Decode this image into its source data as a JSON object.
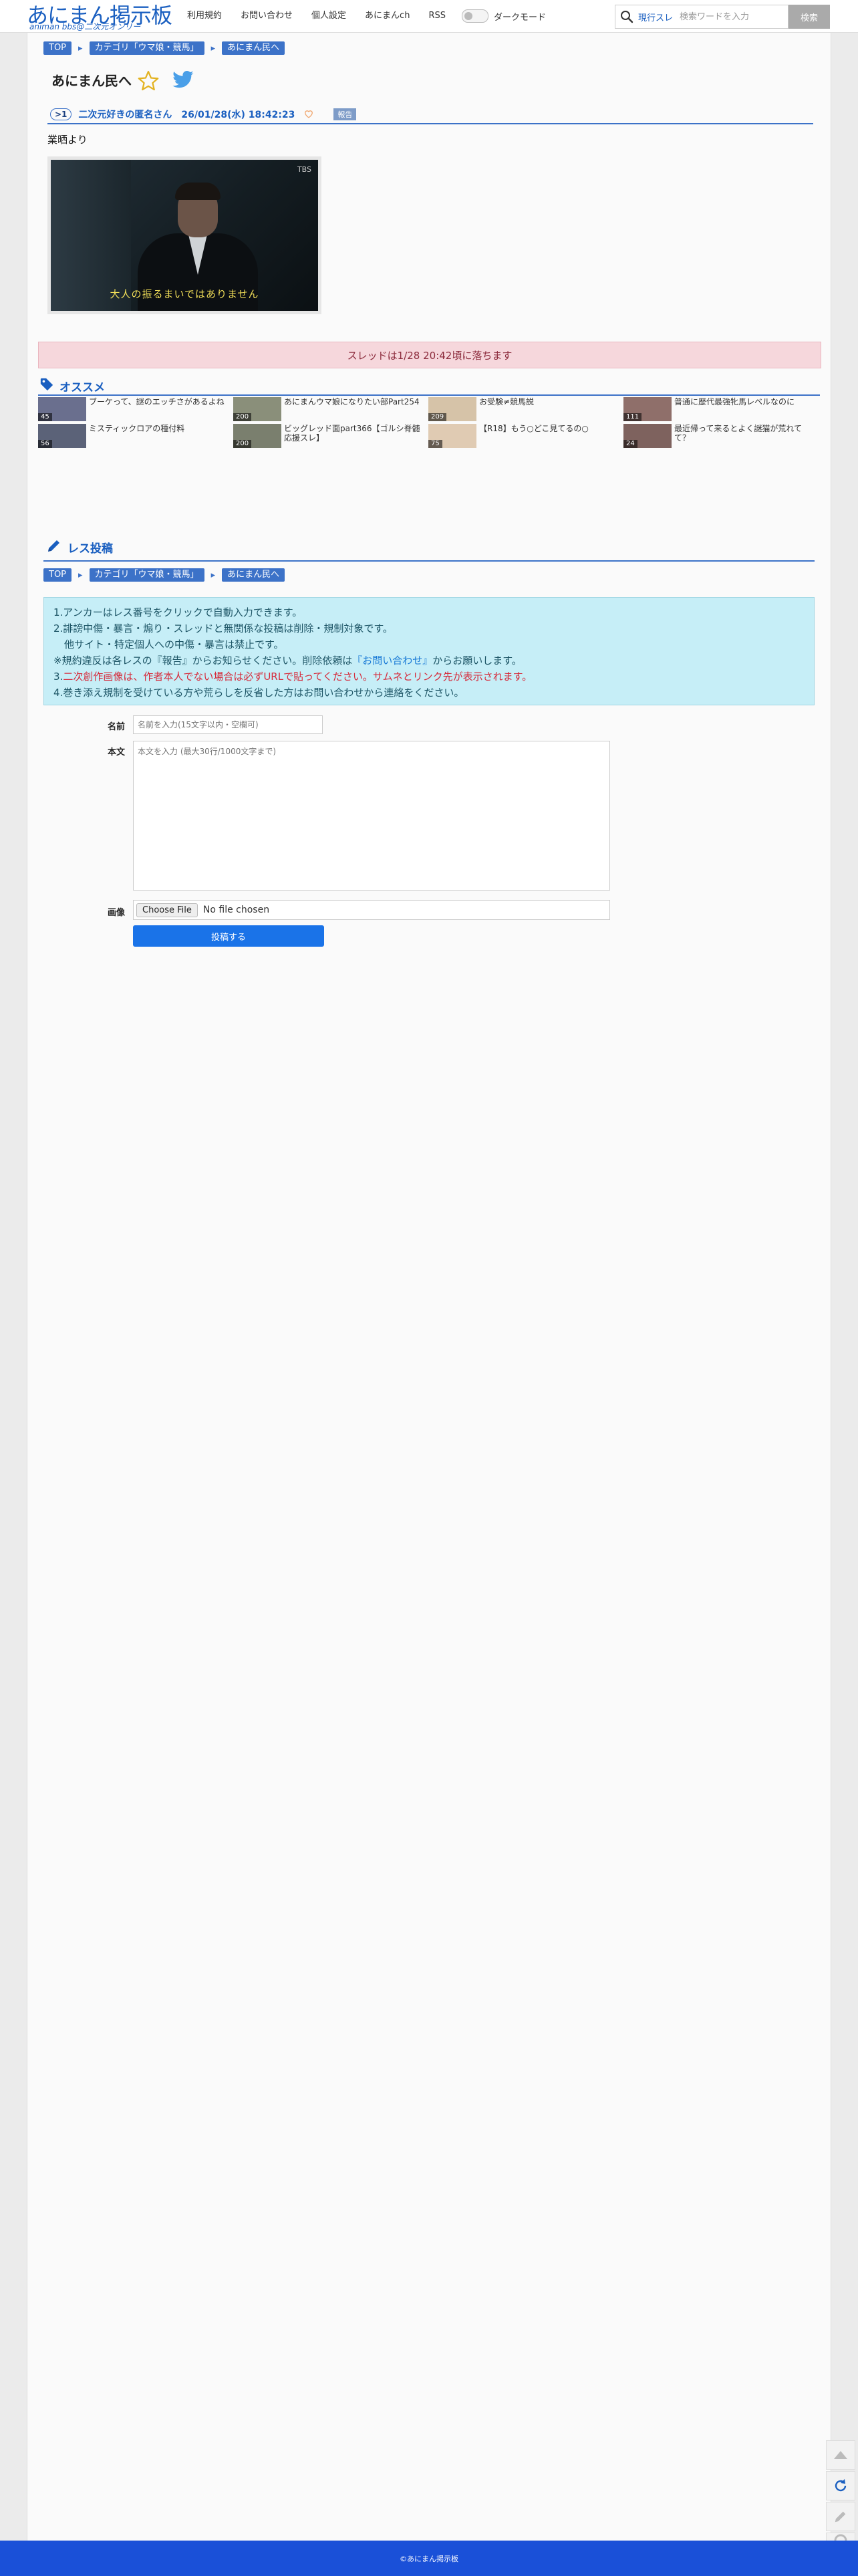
{
  "header": {
    "logo_main": "あにまん掲示板",
    "logo_sub": "animan bbs@二次元オンリー",
    "nav": [
      "利用規約",
      "お問い合わせ",
      "個人設定",
      "あにまんch",
      "RSS"
    ],
    "dark_mode_label": "ダークモード",
    "search_scope": "現行スレ",
    "search_placeholder": "検索ワードを入力",
    "search_button": "検索"
  },
  "breadcrumb": [
    "TOP",
    "カテゴリ「ウマ娘・競馬」",
    "あにまん民へ"
  ],
  "thread": {
    "title": "あにまん民へ",
    "res": {
      "number": ">1",
      "name": "二次元好きの匿名さん",
      "date": "26/01/28(水) 18:42:23",
      "report": "報告",
      "body": "業晒より",
      "image_subtitle": "大人の振るまいではありません",
      "image_logo": "TBS"
    },
    "notice": "スレッドは1/28 20:42頃に落ちます"
  },
  "recommend": {
    "heading": "オススメ",
    "items": [
      {
        "title": "ブーケって、謎のエッチさがあるよね",
        "count": "45"
      },
      {
        "title": "あにまんウマ娘になりたい部Part254",
        "count": "200"
      },
      {
        "title": "お受験≠競馬説",
        "count": "209"
      },
      {
        "title": "普通に歴代最強牝馬レベルなのに",
        "count": "111"
      },
      {
        "title": "ミスティックロアの種付料",
        "count": "56"
      },
      {
        "title": "ビッグレッド面part366【ゴルシ脊髄応援スレ】",
        "count": "200"
      },
      {
        "title": "【R18】もう○どこ見てるの○",
        "count": "75"
      },
      {
        "title": "最近帰って来るとよく謎猫が荒れてて？",
        "count": "24"
      }
    ],
    "thumb_colors": [
      "#6a6f8e",
      "#8a8f7a",
      "#d6c3a8",
      "#8f6f6a"
    ]
  },
  "post_form": {
    "heading": "レス投稿",
    "rules": {
      "l1": "1.アンカーはレス番号をクリックで自動入力できます。",
      "l2": "2.誹謗中傷・暴言・煽り・スレッドと無関係な投稿は削除・規制対象です。",
      "l2b": "他サイト・特定個人への中傷・暴言は禁止です。",
      "l3a": "※規約違反は各レスの『報告』からお知らせください。削除依頼は",
      "l3link": "『お問い合わせ』",
      "l3b": "からお願いします。",
      "l4a": "3.",
      "l4red": "二次創作画像は、作者本人でない場合は必ずURLで貼ってください。サムネとリンク先が表示されます。",
      "l5": "4.巻き添え規制を受けている方や荒らしを反省した方はお問い合わせから連絡をください。"
    },
    "name_label": "名前",
    "name_placeholder": "名前を入力(15文字以内・空欄可)",
    "body_label": "本文",
    "body_placeholder": "本文を入力 (最大30行/1000文字まで)",
    "image_label": "画像",
    "file_button": "Choose File",
    "file_status": "No file chosen",
    "submit": "投稿する"
  },
  "footer": "©あにまん掲示板",
  "colors": {
    "accent": "#1a5fc0",
    "footer": "#1a50d8",
    "notice_bg": "#f6d7dc",
    "rules_bg": "#c6eef7"
  }
}
